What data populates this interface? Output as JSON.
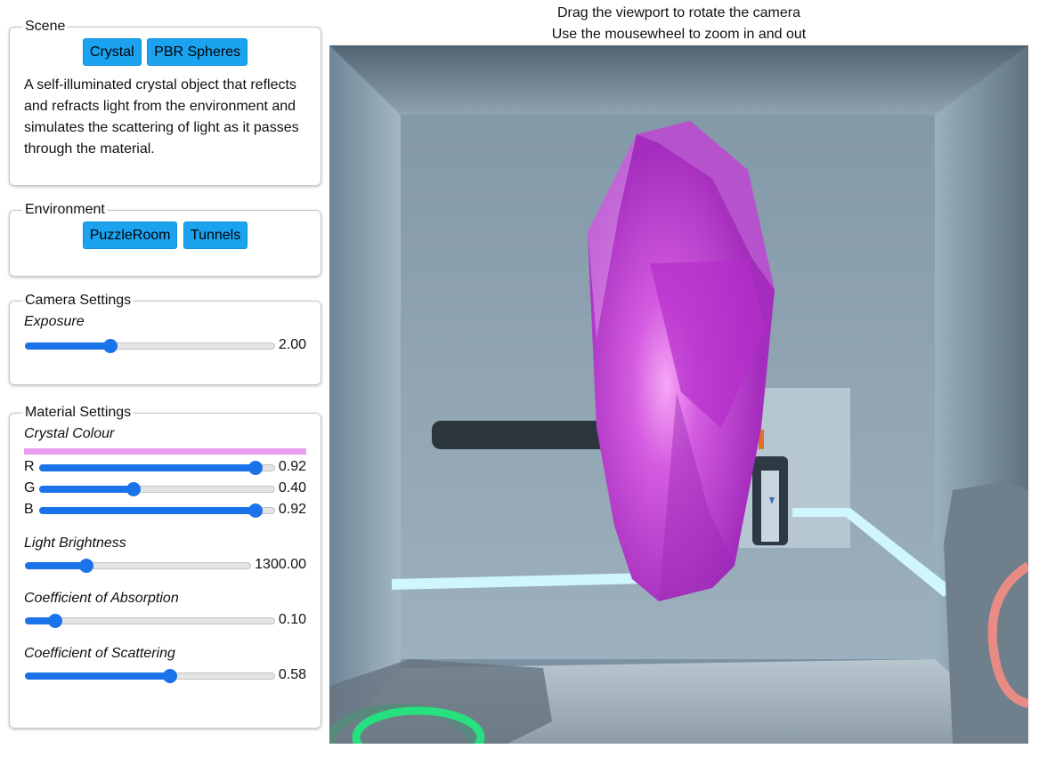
{
  "scene": {
    "legend": "Scene",
    "buttons": [
      "Crystal",
      "PBR Spheres"
    ],
    "description": "A self-illuminated crystal object that reflects and refracts light from the environment and simulates the scattering of light as it passes through the material."
  },
  "environment": {
    "legend": "Environment",
    "buttons": [
      "PuzzleRoom",
      "Tunnels"
    ]
  },
  "camera": {
    "legend": "Camera Settings",
    "exposure_label": "Exposure",
    "exposure_value": "2.00",
    "exposure_fraction": 0.34
  },
  "material": {
    "legend": "Material Settings",
    "colour_label": "Crystal Colour",
    "swatch_color": "#eb9ff0",
    "channels": [
      {
        "name": "R",
        "value": "0.92",
        "fraction": 0.92
      },
      {
        "name": "G",
        "value": "0.40",
        "fraction": 0.4
      },
      {
        "name": "B",
        "value": "0.92",
        "fraction": 0.92
      }
    ],
    "brightness_label": "Light Brightness",
    "brightness_value": "1300.00",
    "brightness_fraction": 0.27,
    "absorption_label": "Coefficient of Absorption",
    "absorption_value": "0.10",
    "absorption_fraction": 0.12,
    "scattering_label": "Coefficient of Scattering",
    "scattering_value": "0.58",
    "scattering_fraction": 0.58
  },
  "hints": {
    "line1": "Drag the viewport to rotate the camera",
    "line2": "Use the mousewheel to zoom in and out"
  },
  "colors": {
    "accent": "#1a73e8",
    "button": "#1ba3f0",
    "crystal": "#c33fd6"
  }
}
